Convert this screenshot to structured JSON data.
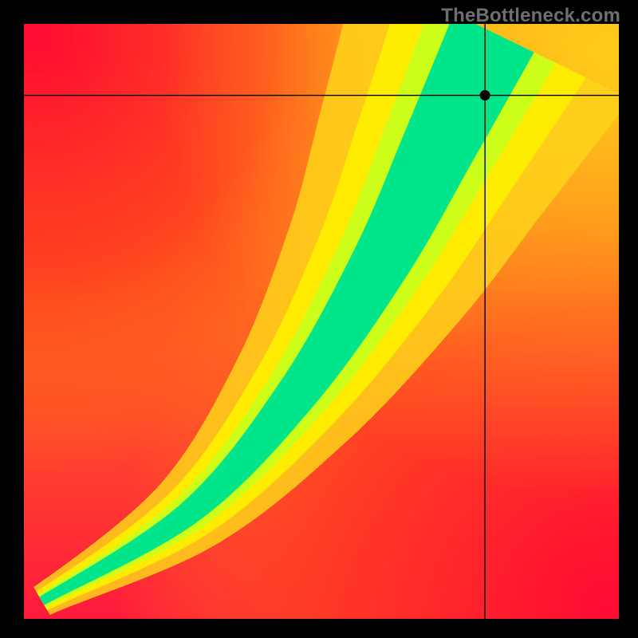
{
  "watermark": "TheBottleneck.com",
  "chart_data": {
    "type": "heatmap",
    "title": "",
    "xlabel": "",
    "ylabel": "",
    "xlim": [
      0,
      1
    ],
    "ylim": [
      0,
      1
    ],
    "grid": false,
    "legend": false,
    "series": [
      {
        "name": "optimal-region",
        "description": "Lower-left to upper-right green ridge where x,y balance; surrounded by yellow/orange/red",
        "values": []
      }
    ],
    "marker": {
      "x": 0.775,
      "y": 0.88
    },
    "crosshair": {
      "x": 0.775,
      "y": 0.88
    },
    "colors": {
      "low": "#ff1744",
      "mid_low": "#ffb300",
      "mid": "#ffee00",
      "good": "#00e58a",
      "high": "#ff1744"
    },
    "ridge": {
      "curve_points": [
        {
          "t": 0.0,
          "x": 0.03,
          "y": 0.03
        },
        {
          "t": 0.2,
          "x": 0.28,
          "y": 0.18
        },
        {
          "t": 0.4,
          "x": 0.46,
          "y": 0.38
        },
        {
          "t": 0.6,
          "x": 0.6,
          "y": 0.6
        },
        {
          "t": 0.8,
          "x": 0.7,
          "y": 0.8
        },
        {
          "t": 1.0,
          "x": 0.79,
          "y": 0.985
        }
      ],
      "half_width_start": 0.008,
      "half_width_end": 0.075
    }
  }
}
